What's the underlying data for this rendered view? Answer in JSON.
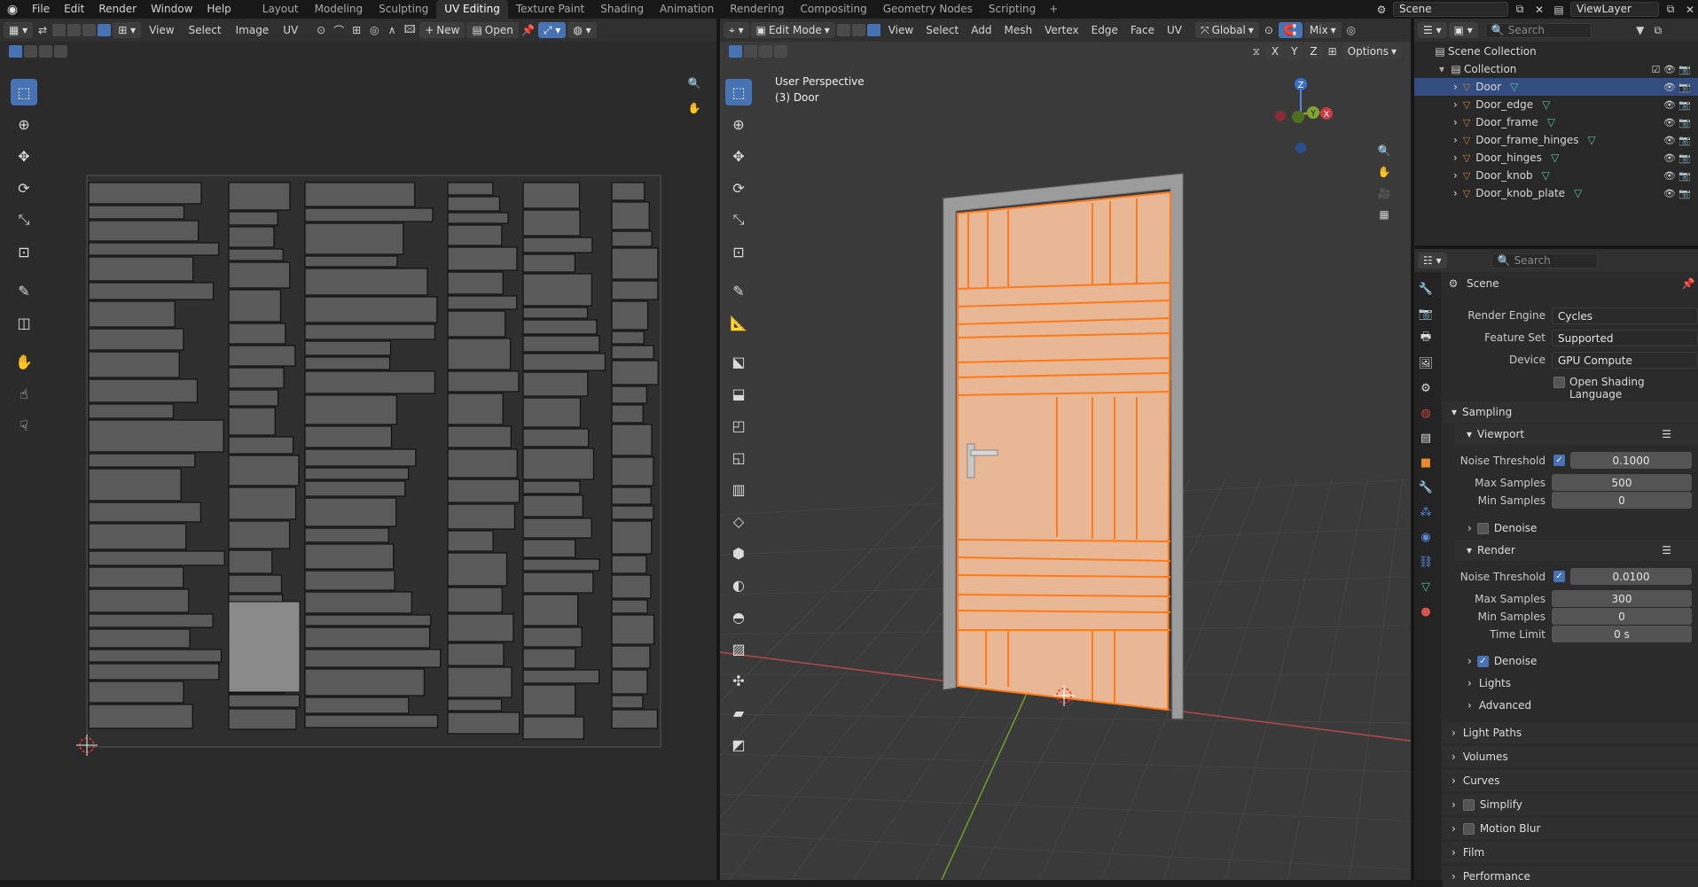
{
  "topbar": {
    "menus": [
      "File",
      "Edit",
      "Render",
      "Window",
      "Help"
    ],
    "workspaces": [
      "Layout",
      "Modeling",
      "Sculpting",
      "UV Editing",
      "Texture Paint",
      "Shading",
      "Animation",
      "Rendering",
      "Compositing",
      "Geometry Nodes",
      "Scripting"
    ],
    "active_workspace": "UV Editing",
    "scene": "Scene",
    "view_layer": "ViewLayer"
  },
  "uv_editor": {
    "menus": [
      "View",
      "Select",
      "Image",
      "UV"
    ],
    "new_label": "New",
    "open_label": "Open"
  },
  "viewport": {
    "mode": "Edit Mode",
    "menus": [
      "View",
      "Select",
      "Add",
      "Mesh",
      "Vertex",
      "Edge",
      "Face",
      "UV"
    ],
    "transform_orientation": "Global",
    "shading": "Mix",
    "options_label": "Options",
    "axes": [
      "X",
      "Y",
      "Z"
    ],
    "overlay_title": "User Perspective",
    "overlay_object": "(3) Door"
  },
  "outliner": {
    "search_placeholder": "Search",
    "scene_collection": "Scene Collection",
    "collection": "Collection",
    "objects": [
      "Door",
      "Door_edge",
      "Door_frame",
      "Door_frame_hinges",
      "Door_hinges",
      "Door_knob",
      "Door_knob_plate"
    ],
    "selected": "Door"
  },
  "properties": {
    "search_placeholder": "Search",
    "context": "Scene",
    "render_engine_label": "Render Engine",
    "render_engine": "Cycles",
    "feature_set_label": "Feature Set",
    "feature_set": "Supported",
    "device_label": "Device",
    "device": "GPU Compute",
    "osl_label": "Open Shading Language",
    "sampling": "Sampling",
    "viewport": "Viewport",
    "noise_threshold_label": "Noise Threshold",
    "vp_noise": "0.1000",
    "max_samples_label": "Max Samples",
    "vp_max": "500",
    "min_samples_label": "Min Samples",
    "vp_min": "0",
    "denoise_label": "Denoise",
    "render": "Render",
    "r_noise": "0.0100",
    "r_max": "300",
    "r_min": "0",
    "time_limit_label": "Time Limit",
    "r_time": "0 s",
    "lights": "Lights",
    "advanced": "Advanced",
    "sections": [
      "Light Paths",
      "Volumes",
      "Curves",
      "Simplify",
      "Motion Blur",
      "Film",
      "Performance"
    ]
  },
  "colors": {
    "accent": "#4772b3",
    "selected_edge": "#ff7a1a",
    "face_fill": "#e8b896",
    "uv_bg": "#5a5a5a"
  }
}
